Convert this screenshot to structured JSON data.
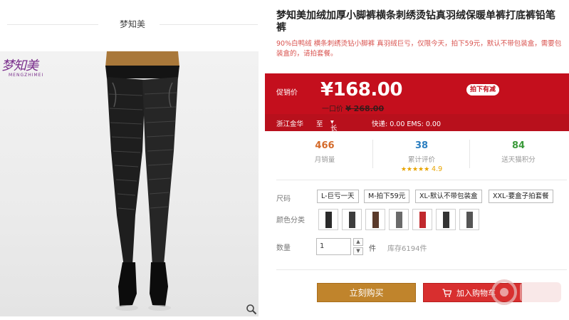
{
  "store": {
    "name": "梦知美"
  },
  "logo": {
    "text_cn": "梦知美",
    "text_en": "MENGZHIMEI"
  },
  "product": {
    "title": "梦知美加绒加厚小脚裤横条刺绣烫钻真羽绒保暖单裤打底裤铅笔裤",
    "subtitle": "90%白鸭绒 横条刺绣烫钻小脚裤 真羽绒巨亏，仅限今天，拍下59元，默认不带包装盒，需要包装盒的，请拍套餐。"
  },
  "price": {
    "label": "促销价",
    "current": "¥168.00",
    "badge": "拍下有减",
    "original_label": "一口价",
    "original": "¥ 268.00"
  },
  "shipping": {
    "from": "浙江金华",
    "to_label": "至",
    "to": "长沙",
    "fee": "快递: 0.00 EMS: 0.00"
  },
  "stats": {
    "monthly_sales": {
      "value": "466",
      "label": "月销量"
    },
    "reviews": {
      "value": "38",
      "label": "累计评价",
      "rating": "4.9",
      "stars": "★★★★★"
    },
    "points": {
      "value": "84",
      "label": "送天猫积分"
    }
  },
  "options": {
    "size_label": "尺码",
    "sizes": [
      "L-巨亏一天",
      "M-拍下59元",
      "XL-默认不带包装盒",
      "XXL-要盒子拍套餐"
    ],
    "color_label": "颜色分类"
  },
  "quantity": {
    "label": "数量",
    "value": "1",
    "unit": "件",
    "stock": "库存6194件"
  },
  "actions": {
    "buy_now": "立刻购买",
    "add_to_cart": "加入购物车"
  },
  "colors": {
    "price_bg": "#c40f1d",
    "buy_btn": "#c0842c",
    "cart_btn": "#d82f2f",
    "sales_num": "#d46a2a",
    "reviews_num": "#2a7ec0",
    "points_num": "#3a9a3a"
  }
}
